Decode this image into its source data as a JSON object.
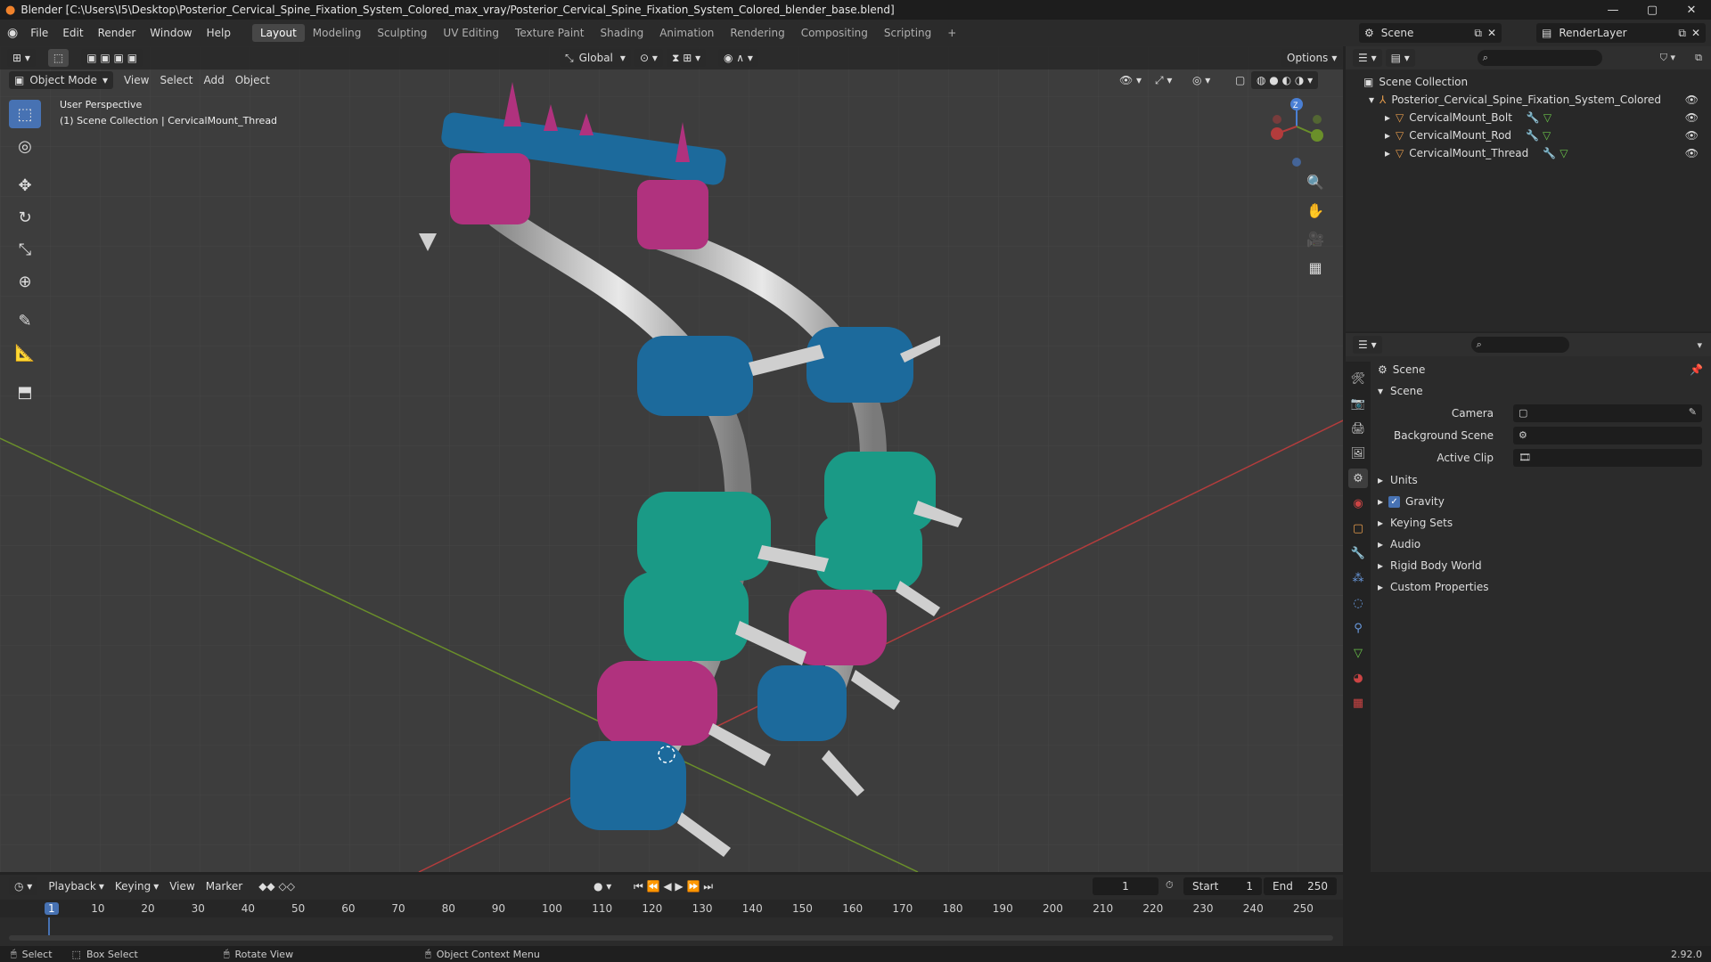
{
  "window": {
    "title": "Blender [C:\\Users\\I5\\Desktop\\Posterior_Cervical_Spine_Fixation_System_Colored_max_vray/Posterior_Cervical_Spine_Fixation_System_Colored_blender_base.blend]",
    "controls": [
      "—",
      "▢",
      "✕"
    ]
  },
  "menu": {
    "items": [
      "File",
      "Edit",
      "Render",
      "Window",
      "Help"
    ],
    "workspaces": [
      "Layout",
      "Modeling",
      "Sculpting",
      "UV Editing",
      "Texture Paint",
      "Shading",
      "Animation",
      "Rendering",
      "Compositing",
      "Scripting"
    ],
    "active_workspace": "Layout",
    "add_workspace": "+",
    "scene_name": "Scene",
    "view_layer": "RenderLayer"
  },
  "viewport": {
    "mode": "Object Mode",
    "menus": [
      "View",
      "Select",
      "Add",
      "Object"
    ],
    "orientation": "Global",
    "options_label": "Options",
    "info_line1": "User Perspective",
    "info_line2": "(1) Scene Collection | CervicalMount_Thread",
    "gizmo_axis_z": "Z",
    "colors": {
      "background": "#3d3d3d",
      "x_axis": "#b33c3c",
      "y_axis": "#6a8f2a",
      "blue_part": "#1c6a9c",
      "green_part": "#1a9a86",
      "magenta_part": "#b0327e",
      "metal": "#c9c9c9"
    }
  },
  "outliner": {
    "root": "Scene Collection",
    "collection": "Posterior_Cervical_Spine_Fixation_System_Colored",
    "objects": [
      "CervicalMount_Bolt",
      "CervicalMount_Rod",
      "CervicalMount_Thread"
    ]
  },
  "properties": {
    "header": "Scene",
    "panel": "Scene",
    "fields": [
      {
        "label": "Camera"
      },
      {
        "label": "Background Scene"
      },
      {
        "label": "Active Clip"
      }
    ],
    "sections": [
      "Units",
      "Gravity",
      "Keying Sets",
      "Audio",
      "Rigid Body World",
      "Custom Properties"
    ],
    "gravity_checked": true
  },
  "timeline": {
    "menus": [
      "Playback",
      "Keying",
      "View",
      "Marker"
    ],
    "current_frame": "1",
    "start_label": "Start",
    "start": "1",
    "end_label": "End",
    "end": "250",
    "ticks": [
      "1",
      "10",
      "20",
      "30",
      "40",
      "50",
      "60",
      "70",
      "80",
      "90",
      "100",
      "110",
      "120",
      "130",
      "140",
      "150",
      "160",
      "170",
      "180",
      "190",
      "200",
      "210",
      "220",
      "230",
      "240",
      "250"
    ]
  },
  "statusbar": {
    "select": "Select",
    "box_select": "Box Select",
    "rotate": "Rotate View",
    "context": "Object Context Menu",
    "version": "2.92.0"
  }
}
